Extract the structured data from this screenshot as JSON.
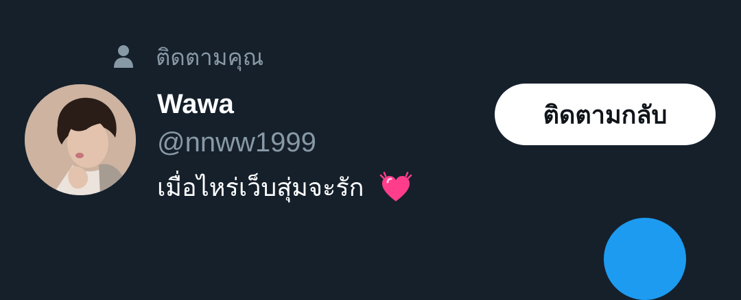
{
  "follower": {
    "context_label": "ติดตามคุณ",
    "context_icon": "person-icon",
    "display_name": "Wawa",
    "handle": "@nnww1999",
    "bio": "เมื่อไหร่เว็บสุ่มจะรัก",
    "bio_emoji": "beating-heart-icon",
    "follow_back_label": "ติดตามกลับ"
  },
  "colors": {
    "background": "#15202b",
    "secondary_text": "#8899a6",
    "button_bg": "#ffffff",
    "button_text": "#0f1419",
    "accent": "#1d9bf0",
    "heart": "#ff3d8b"
  },
  "fab": {
    "icon": "compose-icon"
  }
}
